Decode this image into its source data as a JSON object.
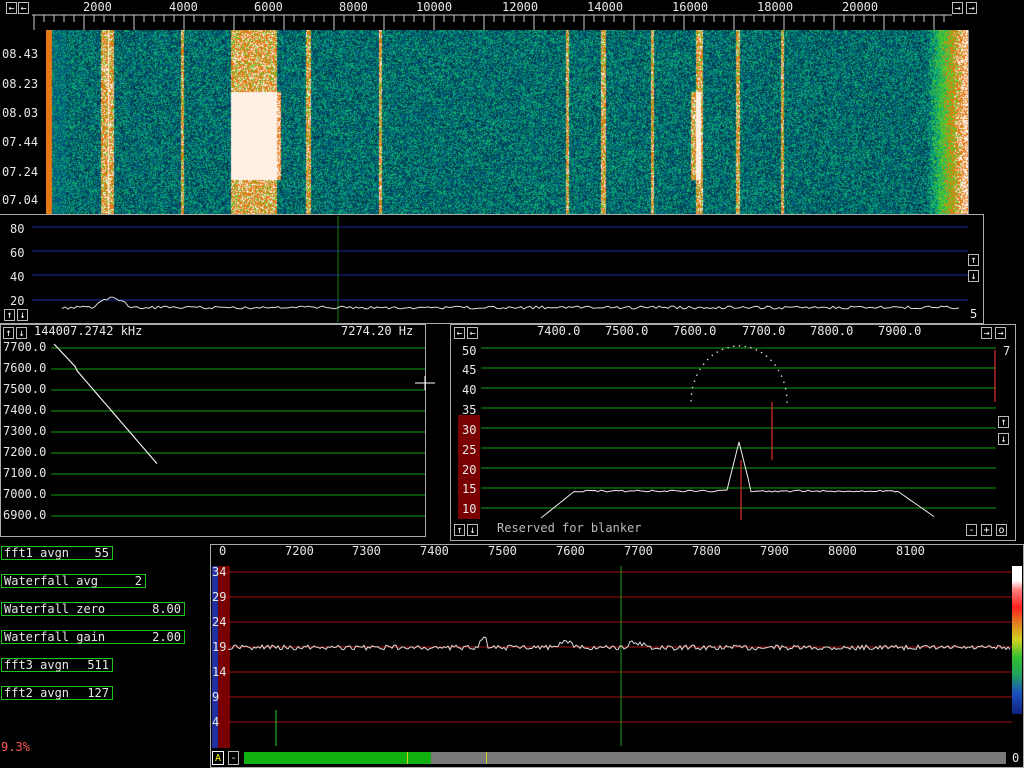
{
  "top_scale": {
    "ticks": [
      "2000",
      "4000",
      "6000",
      "8000",
      "10000",
      "12000",
      "14000",
      "16000",
      "18000",
      "20000"
    ]
  },
  "waterfall": {
    "time_labels": [
      "08.43",
      "08.23",
      "08.03",
      "07.44",
      "07.24",
      "07.04"
    ]
  },
  "wide_spectrum": {
    "y_labels": [
      "80",
      "60",
      "40",
      "20"
    ],
    "right_value": "5"
  },
  "baseband_left": {
    "freq_readout": "144007.2742 kHz",
    "hz_readout": "7274.20 Hz",
    "y_labels": [
      "7700.0",
      "7600.0",
      "7500.0",
      "7400.0",
      "7300.0",
      "7200.0",
      "7100.0",
      "7000.0",
      "6900.0"
    ]
  },
  "baseband_right": {
    "x_ticks": [
      "7400.0",
      "7500.0",
      "7600.0",
      "7700.0",
      "7800.0",
      "7900.0"
    ],
    "y_labels": [
      "50",
      "45",
      "40",
      "35",
      "30",
      "25",
      "20",
      "15",
      "10"
    ],
    "right_value": "7",
    "blanker_text": "Reserved for blanker"
  },
  "params": [
    {
      "label": "fft1 avgn",
      "value": "55"
    },
    {
      "label": "Waterfall avg",
      "value": "2"
    },
    {
      "label": "Waterfall zero",
      "value": "8.00"
    },
    {
      "label": "Waterfall gain",
      "value": "2.00"
    },
    {
      "label": "fft3 avgn",
      "value": "511"
    },
    {
      "label": "fft2 avgn",
      "value": "127"
    }
  ],
  "cpu_load": "9.3%",
  "bottom_spectrum": {
    "left_label": "0",
    "x_ticks": [
      "7200",
      "7300",
      "7400",
      "7500",
      "7600",
      "7700",
      "7800",
      "7900",
      "8000",
      "8100"
    ],
    "y_labels": [
      "34",
      "29",
      "24",
      "19",
      "14",
      "9",
      "4"
    ],
    "right_value": "0"
  },
  "buttons": {
    "left": "←",
    "right": "→",
    "up": "↑",
    "down": "↓",
    "minus": "-",
    "plus": "+",
    "zero": "o",
    "a": "A"
  },
  "colors": {
    "grid_blue": "#1a2aa8",
    "grid_green": "#10a010",
    "grid_red": "#a01010",
    "accent_red": "#e03030",
    "field_green": "#1ec31e",
    "bar_green": "#10b010"
  }
}
